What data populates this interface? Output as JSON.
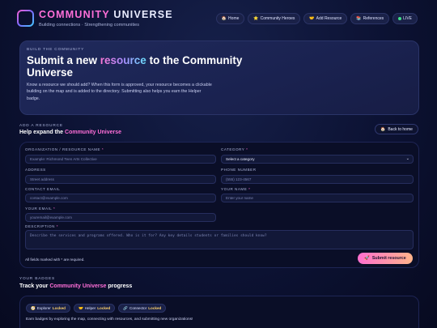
{
  "header": {
    "brand_part1": "COMMUNITY",
    "brand_part2": "UNIVERSE",
    "tagline": "Building connections · Strengthening communities",
    "nav": [
      {
        "icon": "🏠",
        "label": "Home"
      },
      {
        "icon": "⭐",
        "label": "Community Heroes"
      },
      {
        "icon": "🤝",
        "label": "Add Resource"
      },
      {
        "icon": "📚",
        "label": "References"
      },
      {
        "label": "LIVE"
      }
    ]
  },
  "hero": {
    "kicker": "BUILD THE COMMUNITY",
    "title_pre": "Submit a new",
    "title_highlight": "resource",
    "title_post": "to the Community Universe",
    "description": "Know a resource we should add? When this form is approved, your resource becomes a clickable building on the map and is added to the directory. Submitting also helps you earn the Helper badge."
  },
  "add_section": {
    "kicker": "ADD A RESOURCE",
    "title_pre": "Help expand the",
    "title_highlight": "Community Universe",
    "back_label": "Back to home"
  },
  "form": {
    "org": {
      "label": "ORGANIZATION / RESOURCE NAME",
      "placeholder": "Example: Richmond Teen Arts Collective"
    },
    "category": {
      "label": "CATEGORY",
      "value": "Select a category"
    },
    "address": {
      "label": "ADDRESS",
      "placeholder": "Street address"
    },
    "phone": {
      "label": "PHONE NUMBER",
      "placeholder": "(555) 123-4567"
    },
    "contact_email": {
      "label": "CONTACT EMAIL",
      "placeholder": "contact@example.com"
    },
    "your_name": {
      "label": "YOUR NAME",
      "placeholder": "Enter your name"
    },
    "your_email": {
      "label": "YOUR EMAIL",
      "placeholder": "youremail@example.com"
    },
    "description": {
      "label": "DESCRIPTION",
      "placeholder": "Describe the services and programs offered. Who is it for? Any key details students or families should know?"
    },
    "required_note": "All fields marked with * are required.",
    "submit_label": "Submit resource",
    "required_mark": "*"
  },
  "badges_section": {
    "kicker": "YOUR BADGES",
    "title_pre": "Track your",
    "title_highlight": "Community Universe",
    "title_post": "progress",
    "badges": [
      {
        "icon": "🧭",
        "name": "Explorer",
        "status": "Locked"
      },
      {
        "icon": "🤝",
        "name": "Helper",
        "status": "Locked"
      },
      {
        "icon": "🔗",
        "name": "Connector",
        "status": "Locked"
      }
    ],
    "description": "Earn badges by exploring the map, connecting with resources, and submitting new organizations!"
  },
  "colors": {
    "accent_pink": "#ff6fd8",
    "background": "#0c1233",
    "card": "#0a0e27",
    "live": "#41e08a"
  }
}
